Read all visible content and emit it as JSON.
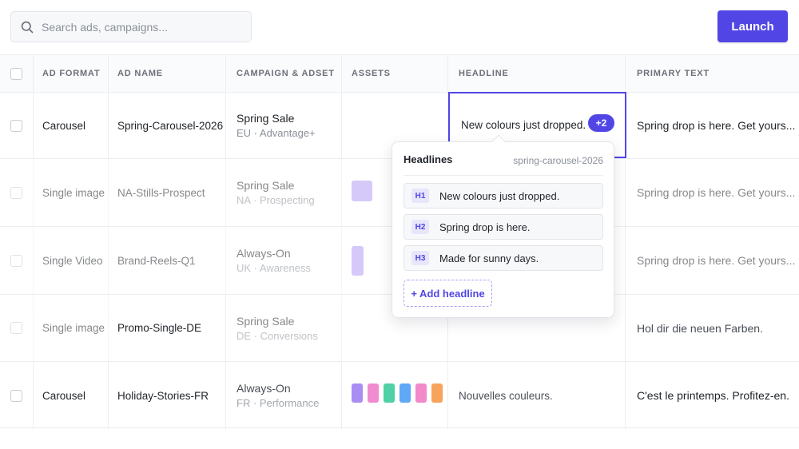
{
  "search": {
    "placeholder": "Search ads, campaigns..."
  },
  "toolbar": {
    "launch_label": "Launch"
  },
  "columns": [
    "AD FORMAT",
    "AD NAME",
    "CAMPAIGN & ADSET",
    "ASSETS",
    "HEADLINE",
    "PRIMARY TEXT"
  ],
  "rows": [
    {
      "format": "Carousel",
      "name": "Spring-Carousel-2026",
      "campaign": "Spring Sale",
      "adset": "EU · Advantage+",
      "headline": "New colours just dropped.",
      "headline_more": "+2",
      "primary_text": "Spring drop is here. Get yours..."
    },
    {
      "format": "Single image",
      "name": "NA-Stills-Prospect",
      "campaign": "Spring Sale",
      "adset": "NA · Prospecting",
      "headline": "",
      "primary_text": "Spring drop is here. Get yours..."
    },
    {
      "format": "Single Video",
      "name": "Brand-Reels-Q1",
      "campaign": "Always-On",
      "adset": "UK · Awareness",
      "headline": "",
      "primary_text": "Spring drop is here. Get yours..."
    },
    {
      "format": "Single image",
      "name": "Promo-Single-DE",
      "campaign": "Spring Sale",
      "adset": "DE · Conversions",
      "headline": "",
      "primary_text": "Hol dir die neuen Farben."
    },
    {
      "format": "Carousel",
      "name": "Holiday-Stories-FR",
      "campaign": "Always-On",
      "adset": "FR · Performance",
      "headline": "Nouvelles couleurs.",
      "primary_text": "C'est le printemps. Profitez-en."
    }
  ],
  "asset_colors": {
    "row2": [
      "#b39cf5"
    ],
    "row3": [
      "#b39cf5"
    ],
    "row5": [
      "#a98df2",
      "#f08bd0",
      "#4fd1a5",
      "#5fa8f5",
      "#f289c9",
      "#f7a35b"
    ]
  },
  "popover": {
    "title": "Headlines",
    "meta": "spring-carousel-2026",
    "items": [
      {
        "tag": "H1",
        "text": "New colours just dropped."
      },
      {
        "tag": "H2",
        "text": "Spring drop is here."
      },
      {
        "tag": "H3",
        "text": "Made for sunny days."
      }
    ],
    "add_label": "+ Add headline"
  },
  "accent": "#5146e5"
}
